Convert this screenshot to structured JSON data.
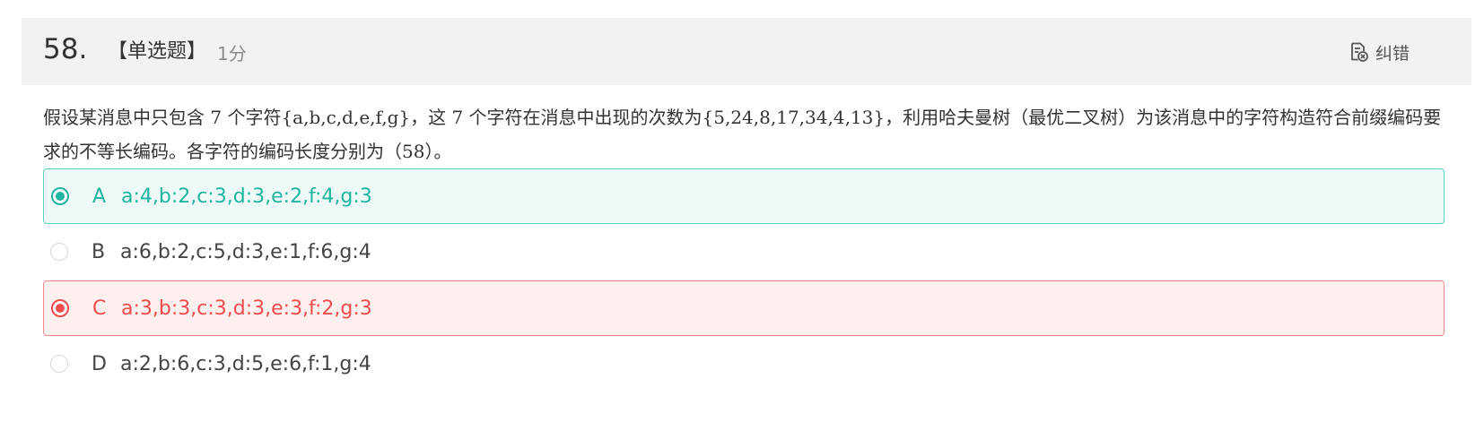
{
  "question": {
    "number": "58.",
    "type_label": "【单选题】",
    "score": "1分",
    "text": "假设某消息中只包含 7 个字符{a,b,c,d,e,f,g}，这 7 个字符在消息中出现的次数为{5,24,8,17,34,4,13}，利用哈夫曼树（最优二叉树）为该消息中的字符构造符合前缀编码要求的不等长编码。各字符的编码长度分别为（58）。"
  },
  "actions": {
    "report_label": "纠错",
    "report_icon": "report-error-icon"
  },
  "options": [
    {
      "letter": "A",
      "text": "a:4,b:2,c:3,d:3,e:2,f:4,g:3",
      "state": "correct"
    },
    {
      "letter": "B",
      "text": "a:6,b:2,c:5,d:3,e:1,f:6,g:4",
      "state": "none"
    },
    {
      "letter": "C",
      "text": "a:3,b:3,c:3,d:3,e:3,f:2,g:3",
      "state": "wrong"
    },
    {
      "letter": "D",
      "text": "a:2,b:6,c:3,d:5,e:6,f:1,g:4",
      "state": "none"
    }
  ],
  "colors": {
    "correct": "#1fb5a0",
    "wrong": "#f14b4b",
    "header_bg": "#f2f2f2"
  }
}
